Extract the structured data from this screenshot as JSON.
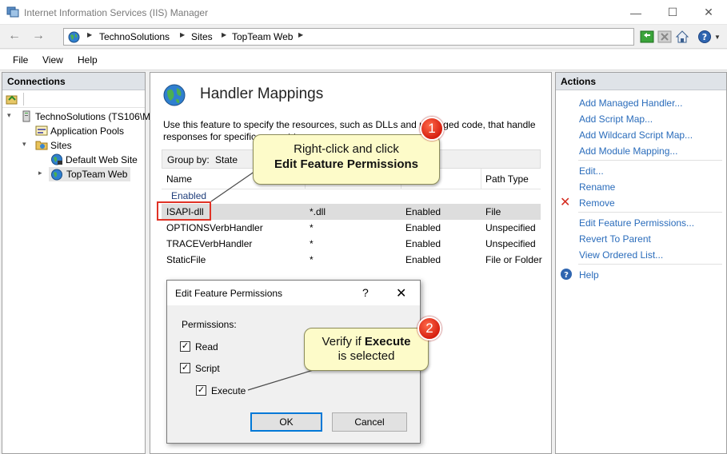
{
  "window": {
    "title": "Internet Information Services (IIS) Manager",
    "minimize": "—",
    "maximize": "☐",
    "close": "✕"
  },
  "address": {
    "crumbs": [
      "TechnoSolutions",
      "Sites",
      "TopTeam Web"
    ]
  },
  "menu": {
    "file": "File",
    "view": "View",
    "help": "Help"
  },
  "connections": {
    "header": "Connections",
    "tree": {
      "server": "TechnoSolutions (TS106\\M",
      "app_pools": "Application Pools",
      "sites": "Sites",
      "default_site": "Default Web Site",
      "topteam": "TopTeam Web"
    }
  },
  "feature": {
    "title": "Handler Mappings",
    "desc_line1": "Use this feature to specify the resources, such as DLLs and managed code, that handle",
    "desc_line2": "responses for specific request types.",
    "group_by_label": "Group by:",
    "group_by_value": "State",
    "columns": {
      "name": "Name",
      "path_type": "Path Type"
    },
    "group": "Enabled",
    "rows": [
      {
        "name": "ISAPI-dll",
        "path": "*.dll",
        "state": "Enabled",
        "type": "File"
      },
      {
        "name": "OPTIONSVerbHandler",
        "path": "*",
        "state": "Enabled",
        "type": "Unspecified"
      },
      {
        "name": "TRACEVerbHandler",
        "path": "*",
        "state": "Enabled",
        "type": "Unspecified"
      },
      {
        "name": "StaticFile",
        "path": "*",
        "state": "Enabled",
        "type": "File or Folder"
      }
    ]
  },
  "actions": {
    "header": "Actions",
    "add_managed": "Add Managed Handler...",
    "add_script": "Add Script Map...",
    "add_wildcard": "Add Wildcard Script Map...",
    "add_module": "Add Module Mapping...",
    "edit": "Edit...",
    "rename": "Rename",
    "remove": "Remove",
    "edit_perm": "Edit Feature Permissions...",
    "revert": "Revert To Parent",
    "view_ordered": "View Ordered List...",
    "help": "Help"
  },
  "dialog": {
    "title": "Edit Feature Permissions",
    "help": "?",
    "close": "✕",
    "permissions": "Permissions:",
    "read": "Read",
    "script": "Script",
    "execute": "Execute",
    "ok": "OK",
    "cancel": "Cancel",
    "check": "✓"
  },
  "callouts": {
    "one": {
      "badge": "1",
      "line1": "Right-click and click",
      "line2": "Edit Feature Permissions"
    },
    "two": {
      "badge": "2",
      "line1a": "Verify if ",
      "line1b": "Execute",
      "line2": "is selected"
    }
  }
}
